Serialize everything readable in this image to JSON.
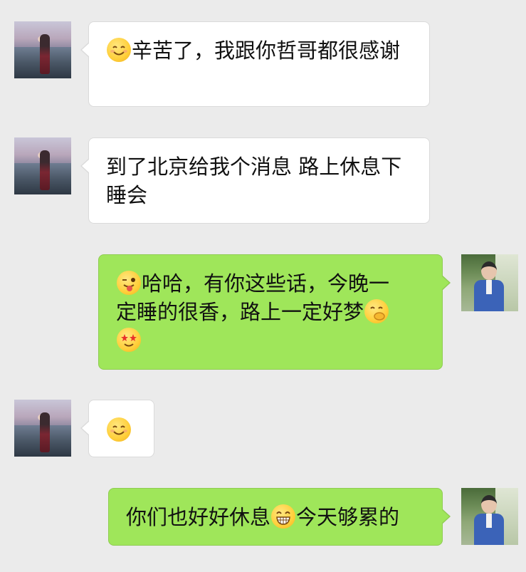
{
  "messages": [
    {
      "side": "left",
      "emoji_before": "smiling-face-icon",
      "text": "辛苦了，我跟你哲哥都很感谢"
    },
    {
      "side": "left",
      "text": "到了北京给我个消息 路上休息下睡会"
    },
    {
      "side": "right",
      "emoji_before": "winking-tongue-face-icon",
      "text_line1": "哈哈，有你这些话，今晚一",
      "text_line2": "定睡的很香，路上一定好梦",
      "emoji_after": "shushing-face-icon",
      "emoji_line3": "star-struck-face-icon"
    },
    {
      "side": "left",
      "emoji_only": "smiling-face-icon"
    },
    {
      "side": "right",
      "text_before": "你们也好好休息",
      "emoji_mid": "grinning-face-icon",
      "text_after": "今天够累的"
    }
  ],
  "colors": {
    "background": "#ebebeb",
    "bubble_left": "#ffffff",
    "bubble_right": "#9fe65a"
  }
}
